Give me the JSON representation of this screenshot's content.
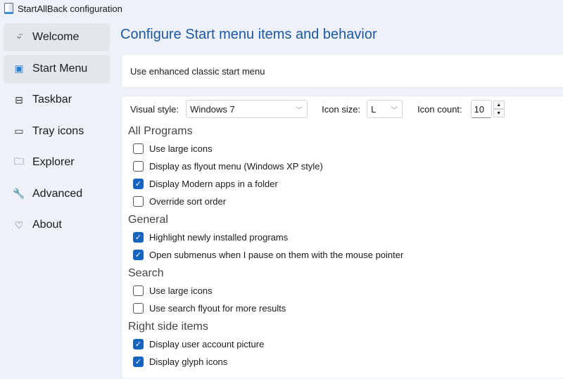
{
  "window": {
    "title": "StartAllBack configuration"
  },
  "sidebar": {
    "items": [
      {
        "label": "Welcome",
        "icon": "smiley-icon",
        "glyph": "ᵕ̈"
      },
      {
        "label": "Start Menu",
        "icon": "start-menu-icon",
        "glyph": "▣"
      },
      {
        "label": "Taskbar",
        "icon": "taskbar-icon",
        "glyph": "⊟"
      },
      {
        "label": "Tray icons",
        "icon": "tray-icon",
        "glyph": "▭"
      },
      {
        "label": "Explorer",
        "icon": "folder-icon",
        "glyph": "🗀"
      },
      {
        "label": "Advanced",
        "icon": "wrench-icon",
        "glyph": "🔧"
      },
      {
        "label": "About",
        "icon": "heart-icon",
        "glyph": "♡"
      }
    ],
    "active": 1
  },
  "main": {
    "title": "Configure Start menu items and behavior",
    "enhanced_label": "Use enhanced classic start menu",
    "visual_style": {
      "label": "Visual style:",
      "value": "Windows 7"
    },
    "icon_size": {
      "label": "Icon size:",
      "value": "L"
    },
    "icon_count": {
      "label": "Icon count:",
      "value": "10"
    },
    "sections": [
      {
        "title": "All Programs",
        "items": [
          {
            "label": "Use large icons",
            "checked": false
          },
          {
            "label": "Display as flyout menu (Windows XP style)",
            "checked": false
          },
          {
            "label": "Display Modern apps in a folder",
            "checked": true
          },
          {
            "label": "Override sort order",
            "checked": false
          }
        ]
      },
      {
        "title": "General",
        "items": [
          {
            "label": "Highlight newly installed programs",
            "checked": true
          },
          {
            "label": "Open submenus when I pause on them with the mouse pointer",
            "checked": true
          }
        ]
      },
      {
        "title": "Search",
        "items": [
          {
            "label": "Use large icons",
            "checked": false
          },
          {
            "label": "Use search flyout for more results",
            "checked": false
          }
        ]
      },
      {
        "title": "Right side items",
        "items": [
          {
            "label": "Display user account picture",
            "checked": true
          },
          {
            "label": "Display glyph icons",
            "checked": true
          }
        ]
      }
    ]
  }
}
